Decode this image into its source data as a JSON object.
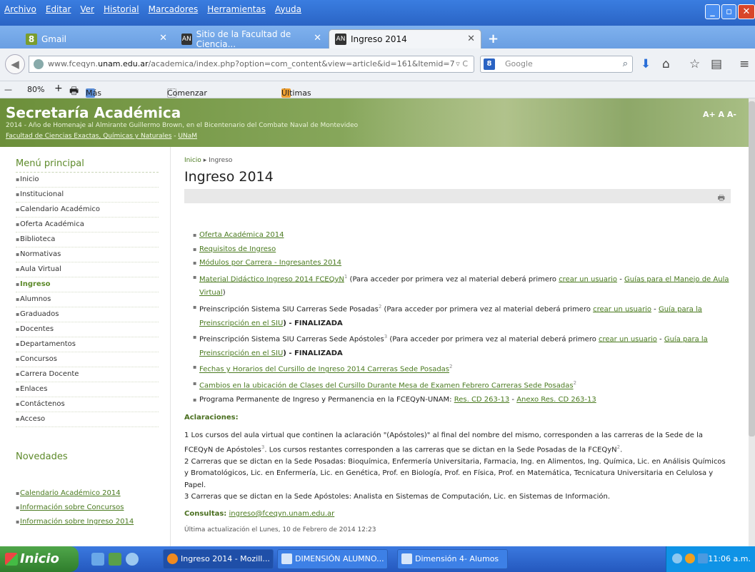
{
  "menubar": {
    "items": [
      "Archivo",
      "Editar",
      "Ver",
      "Historial",
      "Marcadores",
      "Herramientas",
      "Ayuda"
    ]
  },
  "tabs": [
    {
      "label": "Gmail",
      "icon": "gmail-icon"
    },
    {
      "label": "Sitio de la Facultad de Ciencia...",
      "icon": "unam-icon"
    },
    {
      "label": "Ingreso 2014",
      "icon": "unam-icon"
    }
  ],
  "nav": {
    "url_prefix": "www.fceqyn.",
    "url_host": "unam.edu.ar",
    "url_path": "/academica/index.php?option=com_content&view=article&id=161&Itemid=7",
    "search_placeholder": "Google"
  },
  "bookmarks": {
    "zoom": "80%",
    "items": [
      "Más visitados",
      "Comenzar a usar Firef...",
      "Últimas noticias"
    ]
  },
  "banner": {
    "title": "Secretaría Académica",
    "subtitle": "2014 - Año de Homenaje al Almirante Guillermo Brown, en el Bicentenario del Combate Naval de Montevideo",
    "faculty_link": "Facultad de Ciencias Exactas, Químicas y Naturales",
    "sep": " - ",
    "unam_link": "UNaM",
    "font_controls": "A+ A A-"
  },
  "sidebar": {
    "menu_title": "Menú principal",
    "items": [
      "Inicio",
      "Institucional",
      "Calendario Académico",
      "Oferta Académica",
      "Biblioteca",
      "Normativas",
      "Aula Virtual",
      "Ingreso",
      "Alumnos",
      "Graduados",
      "Docentes",
      "Departamentos",
      "Concursos",
      "Carrera Docente",
      "Enlaces",
      "Contáctenos",
      "Acceso"
    ],
    "active_index": 7,
    "news_title": "Novedades",
    "news": [
      "Calendario Académico 2014",
      "Información sobre Concursos",
      "Información sobre Ingreso 2014"
    ]
  },
  "main": {
    "crumb_home": "Inicio",
    "crumb_sep": "▸",
    "crumb_current": "Ingreso",
    "title": "Ingreso 2014",
    "links": {
      "l1": "Oferta Académica 2014",
      "l2": "Requisitos de Ingreso",
      "l3": "Módulos por Carrera - Ingresantes 2014",
      "l4": "Material Didáctico Ingreso 2014 FCEQyN",
      "l4_sup": "1",
      "l4_text": " (Para acceder por primera vez al material deberá primero ",
      "crear": "crear un usuario",
      "dash": " - ",
      "l4_guia": "Guías para el Manejo de Aula Virtual",
      "close_paren": ")",
      "l5_text": "Preinscripción Sistema SIU Carreras Sede Posadas",
      "l5_sup": "2",
      "l5_text2": " (Para acceder por primera vez al material deberá primero ",
      "l5_guia": "Guía para la Preinscripción en el SIU",
      "l5_fin": ") - FINALIZADA",
      "l6_text": "Preinscripción Sistema SIU Carreras Sede Apóstoles",
      "l6_sup": "3",
      "l6_text2": " (Para acceder por primera vez al material deberá primero ",
      "l6_guia": "Guía para la Preinscripción en el SIU",
      "l6_fin": ") - FINALIZADA",
      "l7": "Fechas y Horarios del Cursillo de Ingreso 2014 Carreras Sede Posadas",
      "l7_sup": "2",
      "l8": "Cambios en la ubicación de Clases del Cursillo Durante Mesa de Examen Febrero Carreras Sede Posadas",
      "l8_sup": "2",
      "l9_text": "Programa Permanente de Ingreso y Permanencia en la FCEQyN-UNAM: ",
      "l9_res": "Res. CD 263-13",
      "l9_anexo": "Anexo Res. CD 263-13"
    },
    "aclaraciones_title": "Aclaraciones:",
    "note1a": "1 Los cursos del aula virtual que continen la aclaración \"(Apóstoles)\" al final del nombre del mismo, corresponden a las carreras de la Sede de la FCEQyN de Apóstoles",
    "note1_sup": "3",
    "note1b": ". Los cursos restantes corresponden a las carreras que se dictan en la Sede Posadas de la FCEQyN",
    "note1_sup2": "2",
    "note1c": ".",
    "note2": "2 Carreras que se dictan en la Sede Posadas: Bioquímica, Enfermería Universitaria, Farmacia, Ing. en Alimentos, Ing. Química, Lic. en Análisis Químicos y Bromatológicos, Lic. en Enfermería, Lic. en Genética, Prof. en Biología, Prof. en Física, Prof. en Matemática, Tecnicatura Universitaria en Celulosa y Papel.",
    "note3": "3 Carreras que se dictan en la Sede Apóstoles: Analista en Sistemas de Computación, Lic. en Sistemas de Información.",
    "consult_label": "Consultas:",
    "consult_email": "ingreso@fceqyn.unam.edu.ar",
    "updated": "Última actualización el Lunes, 10 de Febrero de 2014 12:23"
  },
  "taskbar": {
    "start": "Inicio",
    "buttons": [
      "Ingreso 2014 - Mozill...",
      "DIMENSIÓN ALUMNO...",
      "Dimensión 4- Alumos ..."
    ],
    "clock": "11:06 a.m."
  }
}
